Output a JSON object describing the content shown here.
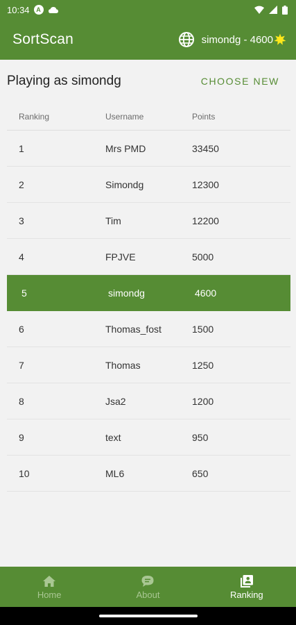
{
  "status_bar": {
    "time": "10:34",
    "indicator": "A",
    "icons": [
      "cloud-icon",
      "wifi-icon",
      "signal-icon",
      "battery-icon"
    ]
  },
  "app_bar": {
    "title": "SortScan",
    "user_score": "simondg - 4600",
    "icons": [
      "globe-icon",
      "star-icon"
    ]
  },
  "header": {
    "playing_as": "Playing as simondg",
    "choose_new": "CHOOSE NEW"
  },
  "table": {
    "columns": [
      "Ranking",
      "Username",
      "Points"
    ],
    "rows": [
      {
        "rank": "1",
        "username": "Mrs PMD",
        "points": "33450"
      },
      {
        "rank": "2",
        "username": "Simondg",
        "points": "12300"
      },
      {
        "rank": "3",
        "username": "Tim",
        "points": "12200"
      },
      {
        "rank": "4",
        "username": "FPJVE",
        "points": "5000"
      },
      {
        "rank": "5",
        "username": "simondg",
        "points": "4600"
      },
      {
        "rank": "6",
        "username": "Thomas_fost",
        "points": "1500"
      },
      {
        "rank": "7",
        "username": "Thomas",
        "points": "1250"
      },
      {
        "rank": "8",
        "username": "Jsa2",
        "points": "1200"
      },
      {
        "rank": "9",
        "username": "text",
        "points": "950"
      },
      {
        "rank": "10",
        "username": "ML6",
        "points": "650"
      }
    ],
    "highlighted_rank": "5"
  },
  "bottom_nav": {
    "items": [
      {
        "label": "Home",
        "icon": "home-icon"
      },
      {
        "label": "About",
        "icon": "chat-bubble-icon"
      },
      {
        "label": "Ranking",
        "icon": "ranking-icon"
      }
    ],
    "active": "Ranking"
  },
  "colors": {
    "brand_green": "#568c34",
    "inactive_nav": "#a9c793",
    "background": "#f2f2f2"
  }
}
